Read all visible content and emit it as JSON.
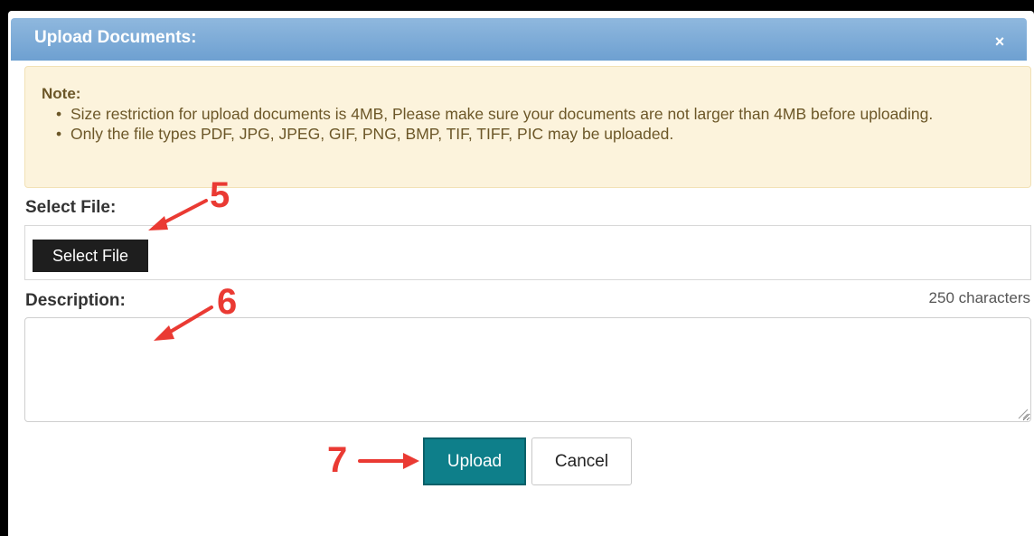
{
  "dialog": {
    "title": "Upload Documents:",
    "close_symbol": "×"
  },
  "note": {
    "heading": "Note:",
    "items": [
      "Size restriction for upload documents is 4MB, Please make sure your documents are not larger than 4MB before uploading.",
      "Only the file types PDF, JPG, JPEG, GIF, PNG, BMP, TIF, TIFF, PIC may be uploaded."
    ]
  },
  "file": {
    "label": "Select File:",
    "button_label": "Select File"
  },
  "description": {
    "label": "Description:",
    "char_limit": "250 characters",
    "value": ""
  },
  "actions": {
    "upload_label": "Upload",
    "cancel_label": "Cancel"
  },
  "annotations": {
    "step_select_file": "5",
    "step_description": "6",
    "step_upload": "7",
    "color": "#ea3a33"
  },
  "colors": {
    "titlebar": "#7aaad6",
    "note_bg": "#fcf3dc",
    "upload_button": "#0e7f8a"
  }
}
